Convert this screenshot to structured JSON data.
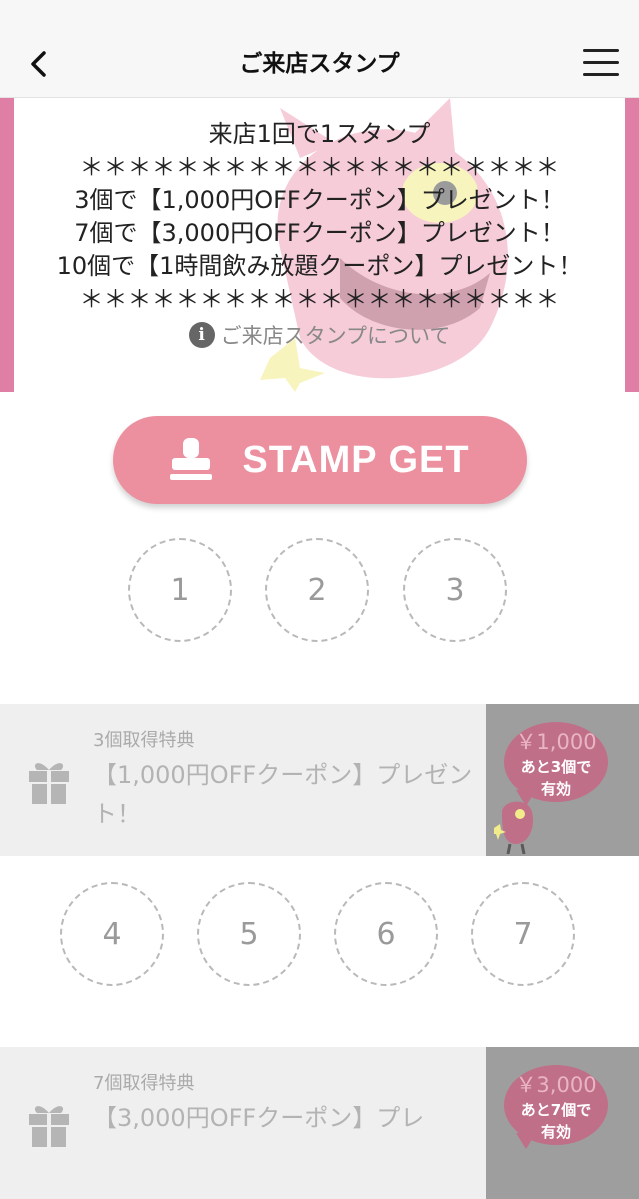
{
  "nav": {
    "title": "ご来店スタンプ"
  },
  "banner": {
    "lines": [
      "来店1回で1スタンプ",
      "＊＊＊＊＊＊＊＊＊＊＊＊＊＊＊＊＊＊＊＊",
      "3個で【1,000円OFFクーポン】プレゼント！",
      "7個で【3,000円OFFクーポン】プレゼント！",
      "10個で【1時間飲み放題クーポン】プレゼント！",
      "＊＊＊＊＊＊＊＊＊＊＊＊＊＊＊＊＊＊＊＊"
    ],
    "info_link": "ご来店スタンプについて"
  },
  "stamp_button": {
    "label": "STAMP GET"
  },
  "stamps_row1": [
    "1",
    "2",
    "3"
  ],
  "stamps_row2": [
    "4",
    "5",
    "6",
    "7"
  ],
  "rewards": [
    {
      "label": "3個取得特典",
      "title": "【1,000円OFFクーポン】プレゼント！",
      "price": "￥1,000",
      "remain": "あと3個で有効"
    },
    {
      "label": "7個取得特典",
      "title": "【3,000円OFFクーポン】プレ",
      "price": "￥3,000",
      "remain": "あと7個で有効"
    }
  ],
  "colors": {
    "accent": "#ec8f9e",
    "banner_bar": "#e07fa6",
    "bubble": "#c06f88"
  }
}
